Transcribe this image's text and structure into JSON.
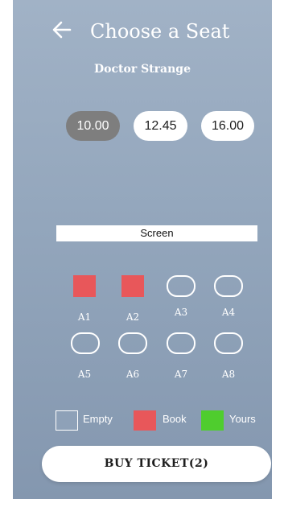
{
  "colors": {
    "background_top": "#a1b2c6",
    "background_bottom": "#8497af",
    "selected_time": "#7e7e7e",
    "booked": "#e8575a",
    "yours": "#4fcd2e",
    "empty": "#8ea1b8"
  },
  "header": {
    "back_icon": "arrow-left-icon",
    "title": "Choose a Seat",
    "movie": "Doctor Strange"
  },
  "showtimes": [
    {
      "label": "10.00",
      "selected": true
    },
    {
      "label": "12.45",
      "selected": false
    },
    {
      "label": "16.00",
      "selected": false
    }
  ],
  "screen_label": "Screen",
  "seats": [
    {
      "label": "A1",
      "status": "booked"
    },
    {
      "label": "A2",
      "status": "booked"
    },
    {
      "label": "A3",
      "status": "empty"
    },
    {
      "label": "A4",
      "status": "empty"
    },
    {
      "label": "A5",
      "status": "empty"
    },
    {
      "label": "A6",
      "status": "empty"
    },
    {
      "label": "A7",
      "status": "empty"
    },
    {
      "label": "A8",
      "status": "empty"
    }
  ],
  "legend": {
    "empty": "Empty",
    "book": "Book",
    "yours": "Yours"
  },
  "buy_button": "BUY TICKET(2)"
}
